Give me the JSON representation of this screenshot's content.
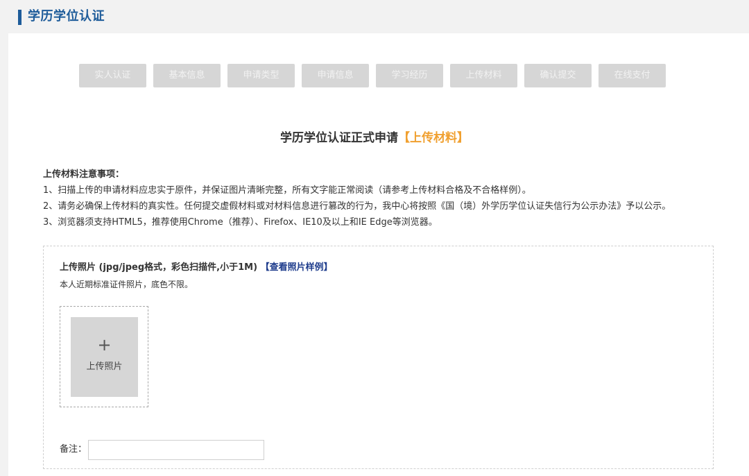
{
  "header": {
    "title": "学历学位认证"
  },
  "steps": [
    "实人认证",
    "基本信息",
    "申请类型",
    "申请信息",
    "学习经历",
    "上传材料",
    "确认提交",
    "在线支付"
  ],
  "main": {
    "title": "学历学位认证正式申请",
    "highlight": "【上传材料】"
  },
  "notes": {
    "title": "上传材料注意事项：",
    "items": [
      "1、扫描上传的申请材料应忠实于原件，并保证图片清晰完整，所有文字能正常阅读（请参考上传材料合格及不合格样例）。",
      "2、请务必确保上传材料的真实性。任何提交虚假材料或对材料信息进行篡改的行为，我中心将按照《国（境）外学历学位认证失信行为公示办法》予以公示。",
      "3、浏览器须支持HTML5，推荐使用Chrome（推荐）、Firefox、IE10及以上和IE Edge等浏览器。"
    ]
  },
  "upload": {
    "label": "上传照片 (jpg/jpeg格式，彩色扫描件,小于1M)",
    "sample_link": "【查看照片样例】",
    "description": "本人近期标准证件照片，底色不限。",
    "plus": "+",
    "button_text": "上传照片"
  },
  "remark": {
    "label": "备注：",
    "value": ""
  },
  "colors": {
    "accent": "#1e5c9a",
    "highlight": "#f0a030",
    "link": "#1e3c8c",
    "step_bg": "#d6d6d6"
  }
}
